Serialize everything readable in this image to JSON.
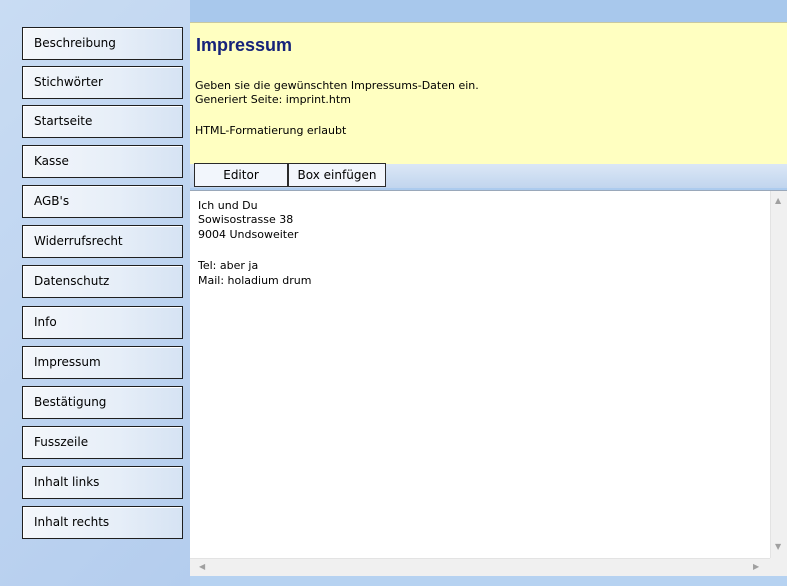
{
  "sidebar": {
    "items": [
      {
        "label": "Beschreibung"
      },
      {
        "label": "Stichwörter"
      },
      {
        "label": "Startseite"
      },
      {
        "label": "Kasse"
      },
      {
        "label": "AGB's"
      },
      {
        "label": "Widerrufsrecht"
      },
      {
        "label": "Datenschutz"
      },
      {
        "label": "Info"
      },
      {
        "label": "Impressum"
      },
      {
        "label": "Bestätigung"
      },
      {
        "label": "Fusszeile"
      },
      {
        "label": "Inhalt links"
      },
      {
        "label": "Inhalt rechts"
      }
    ]
  },
  "header": {
    "title": "Impressum",
    "instruction": "Geben sie die gewünschten Impressums-Daten ein.",
    "generated_page": "Generiert Seite: imprint.htm",
    "formatting_note": "HTML-Formatierung erlaubt"
  },
  "toolbar": {
    "editor_label": "Editor",
    "insert_box_label": "Box einfügen"
  },
  "editor": {
    "lines": [
      "Ich und Du",
      "Sowisostrasse 38",
      "9004 Undsoweiter",
      "",
      "Tel: aber ja",
      "Mail: holadium drum"
    ]
  },
  "scrollbars": {
    "up_arrow": "▲",
    "down_arrow": "▼",
    "left_arrow": "◀",
    "right_arrow": "▶"
  }
}
